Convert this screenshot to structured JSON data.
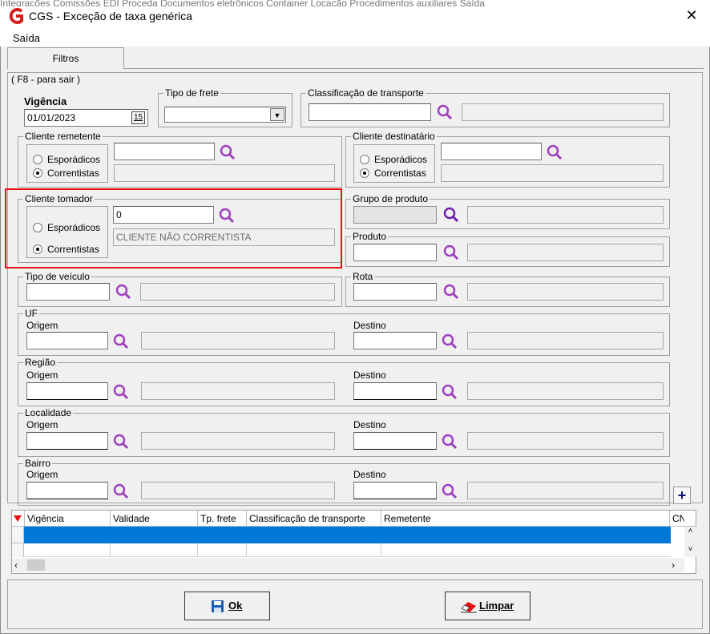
{
  "window": {
    "title": "CGS - Exceção de taxa genérica",
    "bg_menu_text": "Integrações   Comissões   EDI Proceda   Documentos eletrônicos   Container   Locação   Procedimentos auxiliares   Saída",
    "close_label": "✕"
  },
  "menu": {
    "saida": "Saída"
  },
  "tabs": {
    "filtros": "Filtros"
  },
  "panel": {
    "caption": "( F8 - para sair )"
  },
  "vigencia": {
    "label": "Vigência",
    "value": "01/01/2023",
    "calendar_label": "15"
  },
  "tipo_frete": {
    "label": "Tipo de frete",
    "value": ""
  },
  "classificacao": {
    "label": "Classificação de transporte",
    "value": ""
  },
  "cliente_remetente": {
    "label": "Cliente remetente",
    "esporadicos": "Esporádicos",
    "correntistas": "Correntistas",
    "selected": "correntistas",
    "code": "",
    "name": ""
  },
  "cliente_destinatario": {
    "label": "Cliente destinatário",
    "esporadicos": "Esporádicos",
    "correntistas": "Correntistas",
    "selected": "correntistas",
    "code": "",
    "name": ""
  },
  "cliente_tomador": {
    "label": "Cliente tomador",
    "esporadicos": "Esporádicos",
    "correntistas": "Correntistas",
    "selected": "correntistas",
    "code": "0",
    "name": "CLIENTE NÃO CORRENTISTA"
  },
  "grupo_produto": {
    "label": "Grupo de produto"
  },
  "produto": {
    "label": "Produto"
  },
  "tipo_veiculo": {
    "label": "Tipo de veículo"
  },
  "rota": {
    "label": "Rota"
  },
  "uf": {
    "label": "UF",
    "origem": "Origem",
    "destino": "Destino"
  },
  "regiao": {
    "label": "Região",
    "origem": "Origem",
    "destino": "Destino"
  },
  "localidade": {
    "label": "Localidade",
    "origem": "Origem",
    "destino": "Destino"
  },
  "bairro": {
    "label": "Bairro",
    "origem": "Origem",
    "destino": "Destino"
  },
  "grid": {
    "columns": [
      "Vigência",
      "Validade",
      "Tp. frete",
      "Classificação de transporte",
      "Remetente",
      "CN"
    ]
  },
  "buttons": {
    "ok": "Ok",
    "limpar": "Limpar",
    "add": "+"
  },
  "colors": {
    "accent": "#0078d7",
    "highlight": "#e81010",
    "search": "#a040c0",
    "logo": "#d42020"
  }
}
